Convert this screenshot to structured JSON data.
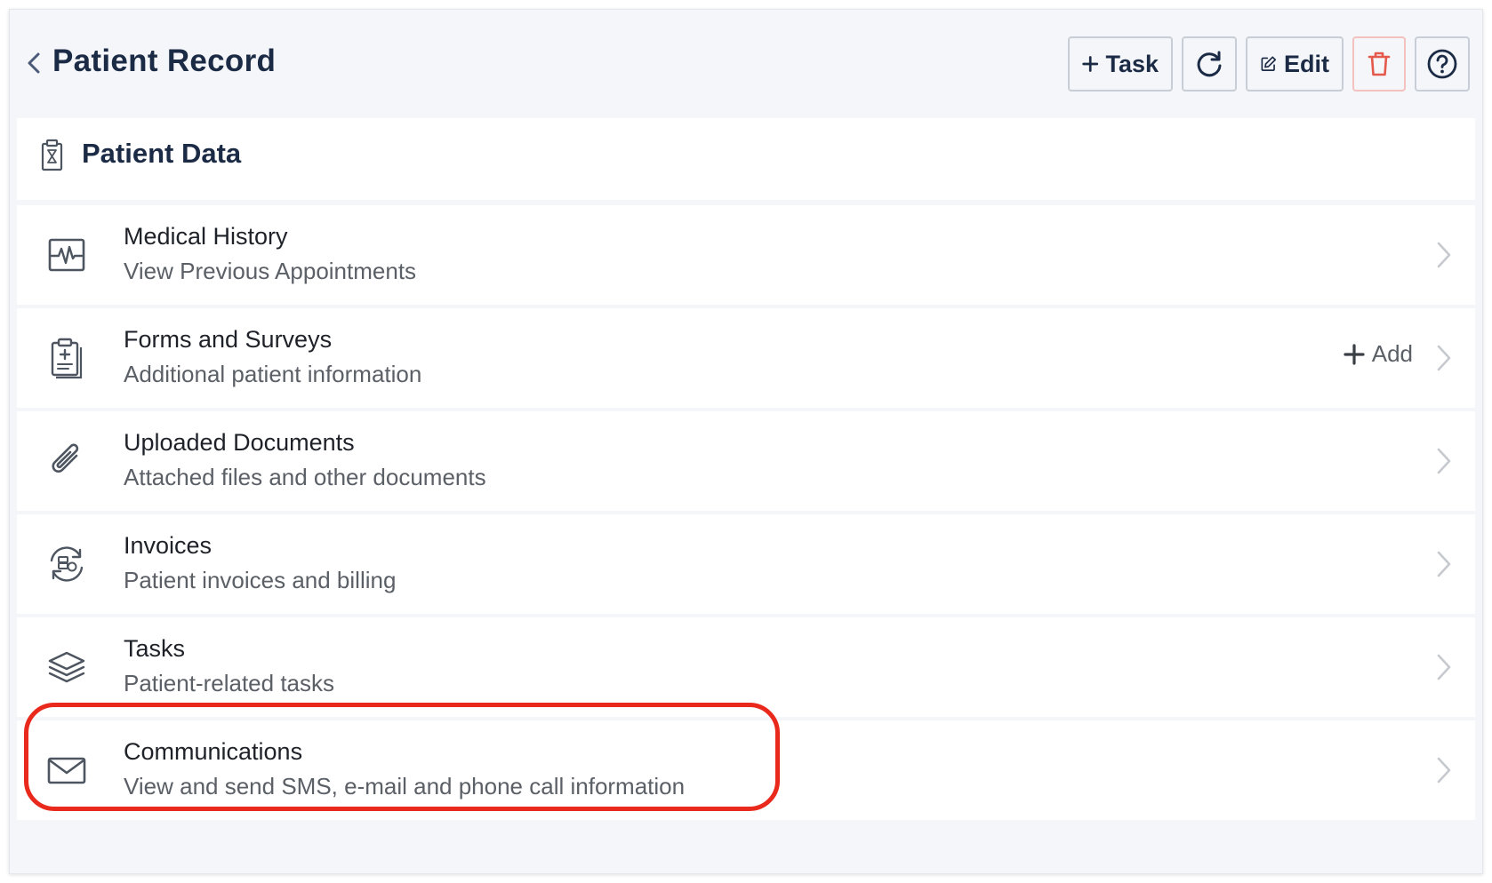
{
  "header": {
    "title": "Patient Record",
    "back_icon": "chevron-left-icon",
    "toolbar": {
      "task_label": "Task",
      "edit_label": "Edit",
      "refresh_icon": "refresh-icon",
      "delete_icon": "trash-icon",
      "help_icon": "help-circle-icon"
    }
  },
  "section": {
    "title": "Patient Data",
    "icon": "clipboard-icon"
  },
  "rows": [
    {
      "title": "Medical History",
      "subtitle": "View Previous Appointments",
      "icon": "heartbeat-monitor-icon"
    },
    {
      "title": "Forms and Surveys",
      "subtitle": "Additional patient information",
      "icon": "medical-clipboard-icon",
      "action": "Add"
    },
    {
      "title": "Uploaded Documents",
      "subtitle": "Attached files and other documents",
      "icon": "paperclip-icon"
    },
    {
      "title": "Invoices",
      "subtitle": "Patient invoices and billing",
      "icon": "billing-cycle-icon"
    },
    {
      "title": "Tasks",
      "subtitle": "Patient-related tasks",
      "icon": "layers-icon"
    },
    {
      "title": "Communications",
      "subtitle": "View and send SMS, e-mail and phone call information",
      "icon": "envelope-icon"
    }
  ],
  "colors": {
    "title_text": "#1c2b45",
    "highlight": "#e8291b",
    "delete_red": "#e5584c",
    "icon_gray": "#5b5f66"
  }
}
